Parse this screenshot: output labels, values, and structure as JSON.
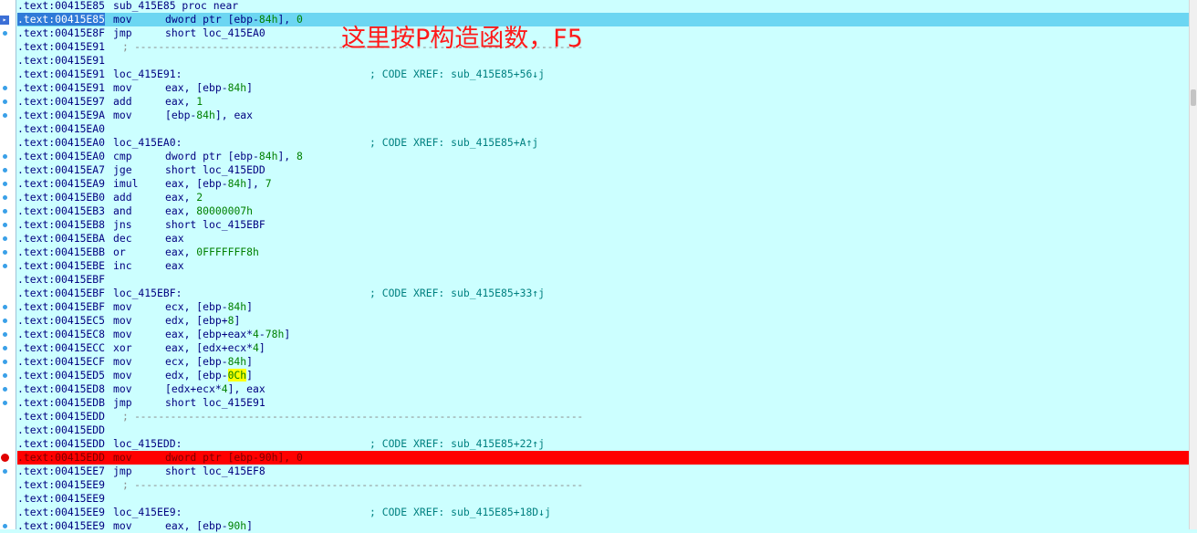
{
  "annotation": {
    "text": "这里按P构造函数，F5",
    "color": "#ff1a1a"
  },
  "colors": {
    "background": "#ccffff",
    "selected_line": "#6cd6f2",
    "breakpoint_line": "#ff0000",
    "immediate": "#008000",
    "comment": "#008080"
  },
  "lines": [
    {
      "addr": ".text:00415E85",
      "mn": "sub_415E85 proc near"
    },
    {
      "addr": ".text:00415E85",
      "mn": "mov",
      "op": [
        "dword ptr [ebp-",
        {
          "n": "84h"
        },
        "], ",
        {
          "n": "0"
        }
      ]
    },
    {
      "addr": ".text:00415E8F",
      "mn": "jmp",
      "op": [
        "short loc_415EA0"
      ]
    },
    {
      "addr": ".text:00415E91",
      "sep": "; ---------------------------------------------------------------------------"
    },
    {
      "addr": ".text:00415E91"
    },
    {
      "addr": ".text:00415E91",
      "label": "loc_415E91:",
      "cmt": "; CODE XREF: sub_415E85+56↓j"
    },
    {
      "addr": ".text:00415E91",
      "mn": "mov",
      "op": [
        "eax, [ebp-",
        {
          "n": "84h"
        },
        "]"
      ]
    },
    {
      "addr": ".text:00415E97",
      "mn": "add",
      "op": [
        "eax, ",
        {
          "n": "1"
        }
      ]
    },
    {
      "addr": ".text:00415E9A",
      "mn": "mov",
      "op": [
        "[ebp-",
        {
          "n": "84h"
        },
        "], eax"
      ]
    },
    {
      "addr": ".text:00415EA0"
    },
    {
      "addr": ".text:00415EA0",
      "label": "loc_415EA0:",
      "cmt": "; CODE XREF: sub_415E85+A↑j"
    },
    {
      "addr": ".text:00415EA0",
      "mn": "cmp",
      "op": [
        "dword ptr [ebp-",
        {
          "n": "84h"
        },
        "], ",
        {
          "n": "8"
        }
      ]
    },
    {
      "addr": ".text:00415EA7",
      "mn": "jge",
      "op": [
        "short loc_415EDD"
      ]
    },
    {
      "addr": ".text:00415EA9",
      "mn": "imul",
      "op": [
        "eax, [ebp-",
        {
          "n": "84h"
        },
        "], ",
        {
          "n": "7"
        }
      ]
    },
    {
      "addr": ".text:00415EB0",
      "mn": "add",
      "op": [
        "eax, ",
        {
          "n": "2"
        }
      ]
    },
    {
      "addr": ".text:00415EB3",
      "mn": "and",
      "op": [
        "eax, ",
        {
          "n": "80000007h"
        }
      ]
    },
    {
      "addr": ".text:00415EB8",
      "mn": "jns",
      "op": [
        "short loc_415EBF"
      ]
    },
    {
      "addr": ".text:00415EBA",
      "mn": "dec",
      "op": [
        "eax"
      ]
    },
    {
      "addr": ".text:00415EBB",
      "mn": "or",
      "op": [
        "eax, ",
        {
          "n": "0FFFFFFF8h"
        }
      ]
    },
    {
      "addr": ".text:00415EBE",
      "mn": "inc",
      "op": [
        "eax"
      ]
    },
    {
      "addr": ".text:00415EBF"
    },
    {
      "addr": ".text:00415EBF",
      "label": "loc_415EBF:",
      "cmt": "; CODE XREF: sub_415E85+33↑j"
    },
    {
      "addr": ".text:00415EBF",
      "mn": "mov",
      "op": [
        "ecx, [ebp-",
        {
          "n": "84h"
        },
        "]"
      ]
    },
    {
      "addr": ".text:00415EC5",
      "mn": "mov",
      "op": [
        "edx, [ebp+",
        {
          "n": "8"
        },
        "]"
      ]
    },
    {
      "addr": ".text:00415EC8",
      "mn": "mov",
      "op": [
        "eax, [ebp+eax*",
        {
          "n": "4"
        },
        "-",
        {
          "n": "78h"
        },
        "]"
      ]
    },
    {
      "addr": ".text:00415ECC",
      "mn": "xor",
      "op": [
        "eax, [edx+ecx*",
        {
          "n": "4"
        },
        "]"
      ]
    },
    {
      "addr": ".text:00415ECF",
      "mn": "mov",
      "op": [
        "ecx, [ebp-",
        {
          "n": "84h"
        },
        "]"
      ]
    },
    {
      "addr": ".text:00415ED5",
      "mn": "mov",
      "op": [
        "edx, [ebp-",
        {
          "n": "0Ch",
          "hl": true
        },
        "]"
      ]
    },
    {
      "addr": ".text:00415ED8",
      "mn": "mov",
      "op": [
        "[edx+ecx*",
        {
          "n": "4"
        },
        "], eax"
      ]
    },
    {
      "addr": ".text:00415EDB",
      "mn": "jmp",
      "op": [
        "short loc_415E91"
      ]
    },
    {
      "addr": ".text:00415EDD",
      "sep": "; ---------------------------------------------------------------------------"
    },
    {
      "addr": ".text:00415EDD"
    },
    {
      "addr": ".text:00415EDD",
      "label": "loc_415EDD:",
      "cmt": "; CODE XREF: sub_415E85+22↑j"
    },
    {
      "addr": ".text:00415EDD",
      "mn": "mov",
      "op": [
        "dword ptr [ebp-",
        {
          "n": "90h"
        },
        "], ",
        {
          "n": "0"
        }
      ]
    },
    {
      "addr": ".text:00415EE7",
      "mn": "jmp",
      "op": [
        "short loc_415EF8"
      ]
    },
    {
      "addr": ".text:00415EE9",
      "sep": "; ---------------------------------------------------------------------------"
    },
    {
      "addr": ".text:00415EE9"
    },
    {
      "addr": ".text:00415EE9",
      "label": "loc_415EE9:",
      "cmt": "; CODE XREF: sub_415E85+18D↓j"
    },
    {
      "addr": ".text:00415EE9",
      "mn": "mov",
      "op": [
        "eax, [ebp-",
        {
          "n": "90h"
        },
        "]"
      ]
    }
  ]
}
